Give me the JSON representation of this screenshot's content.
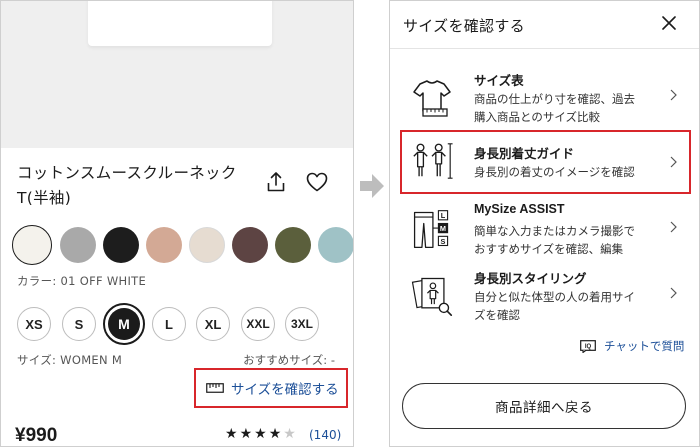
{
  "product": {
    "title_line1": "コットンスムースクルーネック",
    "title_line2": "T(半袖)",
    "color_label": "カラー: 01 OFF WHITE",
    "size_label": "サイズ: WOMEN M",
    "recommend_label": "おすすめサイズ: -",
    "size_check_link": "サイズを確認する",
    "price": "¥990",
    "rating": 4,
    "rating_max": 5,
    "review_count": "(140)"
  },
  "colors": [
    {
      "hex": "#f4f2ec",
      "selected": true
    },
    {
      "hex": "#a9a9a9",
      "selected": false
    },
    {
      "hex": "#1d1d1d",
      "selected": false
    },
    {
      "hex": "#d3a995",
      "selected": false
    },
    {
      "hex": "#e6dcd1",
      "selected": false
    },
    {
      "hex": "#5d4443",
      "selected": false
    },
    {
      "hex": "#5b5f3c",
      "selected": false
    },
    {
      "hex": "#9fc2c6",
      "selected": false
    }
  ],
  "sizes": [
    {
      "label": "XS",
      "selected": false
    },
    {
      "label": "S",
      "selected": false
    },
    {
      "label": "M",
      "selected": true
    },
    {
      "label": "L",
      "selected": false
    },
    {
      "label": "XL",
      "selected": false
    },
    {
      "label": "XXL",
      "selected": false
    },
    {
      "label": "3XL",
      "selected": false
    }
  ],
  "sheet": {
    "title": "サイズを確認する",
    "options": [
      {
        "title": "サイズ表",
        "desc_line1": "商品の仕上がり寸を確認、過去",
        "desc_line2": "購入商品とのサイズ比較",
        "icon": "tshirt-ruler-icon"
      },
      {
        "title": "身長別着丈ガイド",
        "desc_line1": "身長別の着丈のイメージを確認",
        "desc_line2": "",
        "icon": "height-guide-icon"
      },
      {
        "title": "MySize ASSIST",
        "desc_line1": "簡単な入力またはカメラ撮影で",
        "desc_line2": "おすすめサイズを確認、編集",
        "icon": "mysize-assist-icon"
      },
      {
        "title": "身長別スタイリング",
        "desc_line1": "自分と似た体型の人の着用サイ",
        "desc_line2": "ズを確認",
        "icon": "styling-icon"
      }
    ],
    "chat_link": "チャットで質問",
    "chat_icon_text": "IQ",
    "back_button": "商品詳細へ戻る",
    "mysize_badges": [
      "L",
      "M",
      "S"
    ]
  },
  "colors_ui": {
    "accent_red": "#d8262b",
    "link_blue": "#1c4f98"
  }
}
